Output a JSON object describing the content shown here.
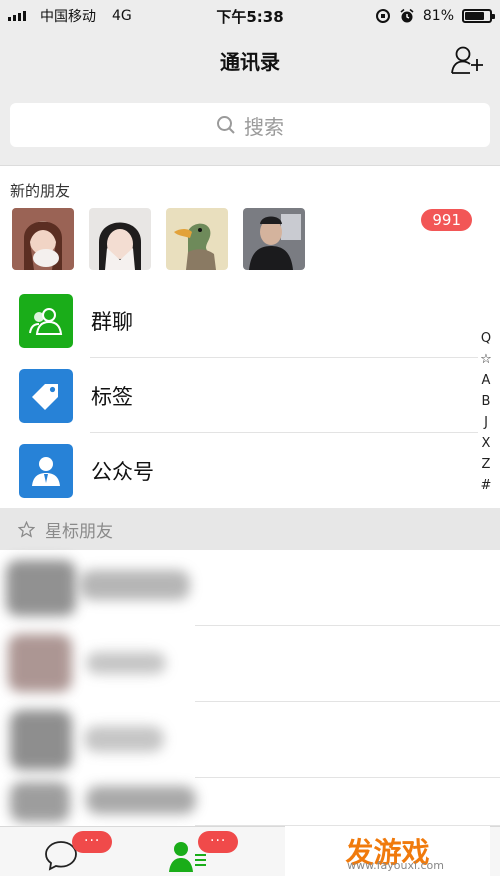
{
  "status_bar": {
    "carrier": "中国移动",
    "network": "4G",
    "time": "下午5:38",
    "battery_percent": "81%",
    "battery_level": 0.81
  },
  "nav": {
    "title": "通讯录",
    "add_friend_icon": "add-friend-icon"
  },
  "search": {
    "placeholder": "搜索"
  },
  "new_friends": {
    "label": "新的朋友",
    "badge": "991"
  },
  "menu": [
    {
      "label": "群聊",
      "icon": "group-chat-icon",
      "color": "#1aad19"
    },
    {
      "label": "标签",
      "icon": "tag-icon",
      "color": "#2782d7"
    },
    {
      "label": "公众号",
      "icon": "official-account-icon",
      "color": "#2782d7"
    }
  ],
  "starred": {
    "label": "星标朋友"
  },
  "alpha_index": [
    "Q",
    "☆",
    "A",
    "B",
    "J",
    "X",
    "Z",
    "#"
  ],
  "tabbar": {
    "chats_badge": "···",
    "contacts_badge": "···"
  },
  "watermark": {
    "text": "发游戏",
    "url": "www.fayouxi.com"
  },
  "colors": {
    "accent_green": "#1aad19",
    "accent_blue": "#2782d7",
    "badge_red": "#f25656"
  }
}
